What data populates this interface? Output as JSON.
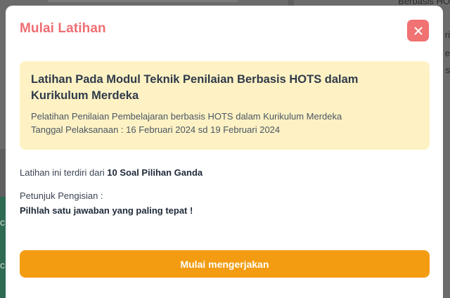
{
  "background": {
    "right_texts": [
      "Berbasis HO",
      "ri",
      "e",
      "s"
    ],
    "left_letters": [
      "c",
      "c"
    ]
  },
  "modal": {
    "title": "Mulai Latihan",
    "close_icon": "close-icon",
    "info": {
      "title": "Latihan Pada Modul Teknik Penilaian Berbasis HOTS dalam Kurikulum Merdeka",
      "subtitle": "Pelatihan Penilaian Pembelajaran berbasis HOTS dalam Kurikulum Merdeka",
      "date": "Tanggal Pelaksanaan : 16 Februari 2024 sd 19 Februari 2024"
    },
    "composition_prefix": "Latihan ini terdiri dari ",
    "composition_value": "10 Soal Pilihan Ganda",
    "instructions_label": "Petunjuk Pengisian :",
    "instructions_text": "Pilhlah satu jawaban yang paling tepat !",
    "start_button": "Mulai mengerjakan"
  },
  "colors": {
    "title": "#ee6e73",
    "close_button": "#f07272",
    "info_box": "#fef2c4",
    "primary_button": "#f39c12",
    "overlay": "#5f5f5f"
  }
}
